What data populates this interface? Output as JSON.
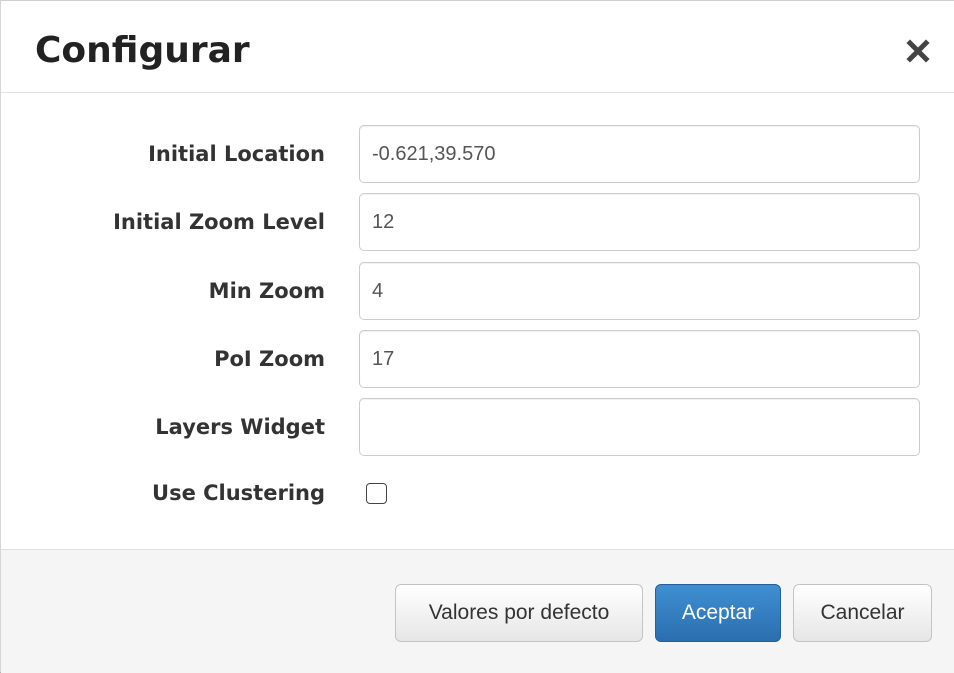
{
  "dialog": {
    "title": "Configurar",
    "close_icon": "close-icon"
  },
  "form": {
    "initial_location": {
      "label": "Initial Location",
      "value": "-0.621,39.570"
    },
    "initial_zoom": {
      "label": "Initial Zoom Level",
      "value": "12"
    },
    "min_zoom": {
      "label": "Min Zoom",
      "value": "4"
    },
    "poi_zoom": {
      "label": "PoI Zoom",
      "value": "17"
    },
    "layers_widget": {
      "label": "Layers Widget",
      "value": ""
    },
    "use_clustering": {
      "label": "Use Clustering",
      "checked": false
    }
  },
  "footer": {
    "defaults_label": "Valores por defecto",
    "accept_label": "Aceptar",
    "cancel_label": "Cancelar"
  },
  "colors": {
    "primary": "#337ab7",
    "title_text": "#222222",
    "footer_bg": "#f5f5f5"
  }
}
